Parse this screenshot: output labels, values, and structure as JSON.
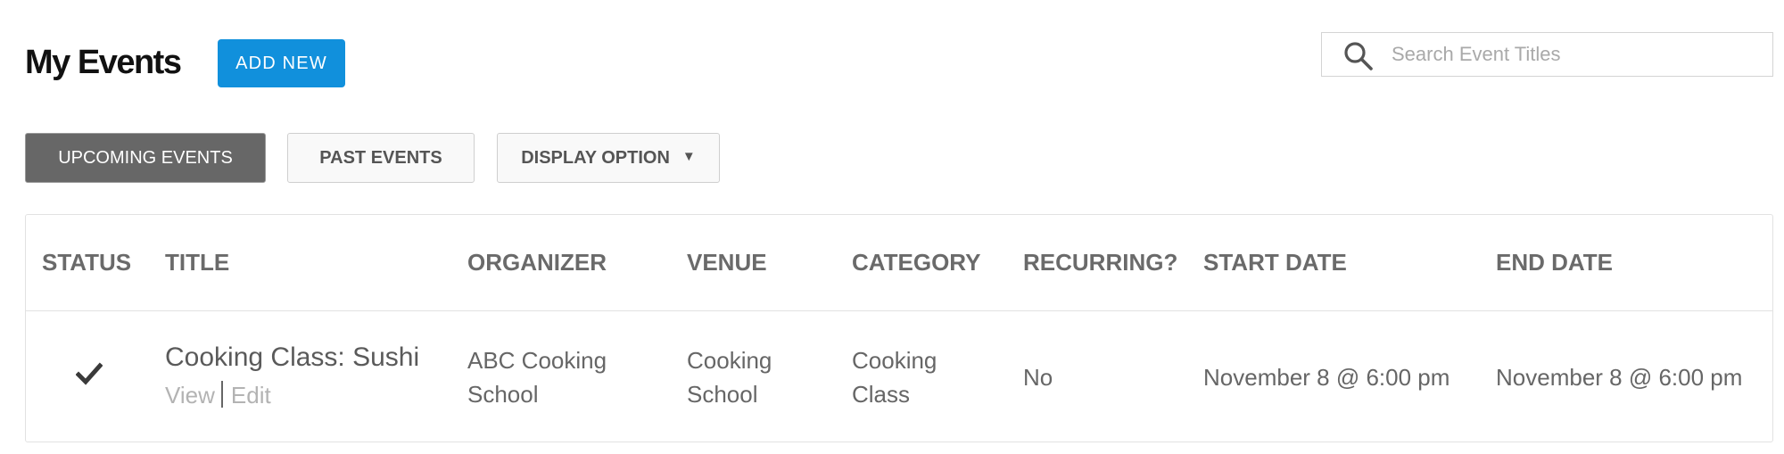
{
  "header": {
    "title": "My Events",
    "add_new_label": "ADD NEW"
  },
  "search": {
    "placeholder": "Search Event Titles",
    "value": "",
    "icon": "search-icon"
  },
  "tabs": {
    "upcoming_label": "UPCOMING EVENTS",
    "past_label": "PAST EVENTS",
    "display_label": "DISPLAY OPTION",
    "display_caret": "▼",
    "active": "UPCOMING EVENTS"
  },
  "table": {
    "columns": [
      "STATUS",
      "TITLE",
      "ORGANIZER",
      "VENUE",
      "CATEGORY",
      "RECURRING?",
      "START DATE",
      "END DATE"
    ],
    "rows": [
      {
        "status_icon": "checkmark-icon",
        "title": "Cooking Class: Sushi",
        "view_label": "View",
        "edit_label": "Edit",
        "organizer_line1": "ABC Cooking",
        "organizer_line2": "School",
        "venue_line1": "Cooking",
        "venue_line2": "School",
        "category_line1": "Cooking",
        "category_line2": "Class",
        "recurring": "No",
        "start_date": "November 8 @ 6:00 pm",
        "end_date": "November 8 @ 6:00 pm"
      }
    ]
  },
  "colors": {
    "accent": "#1190dc",
    "active_tab": "#676767",
    "text_muted": "#b3b3b3"
  }
}
